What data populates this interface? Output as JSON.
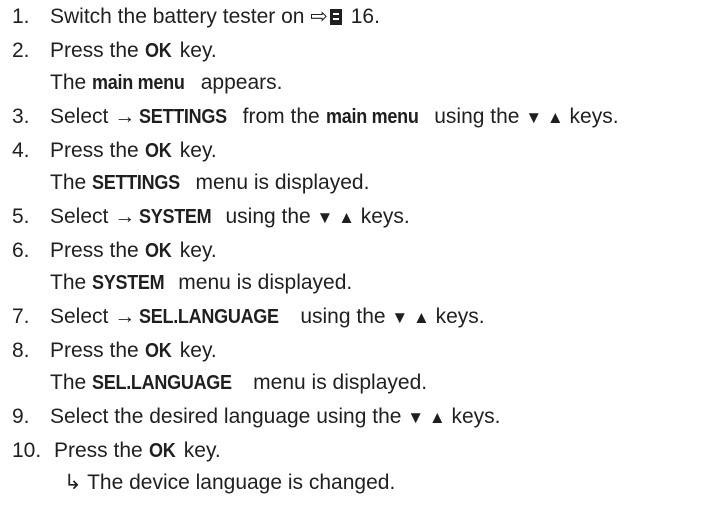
{
  "steps": [
    {
      "num": "1.",
      "a": "Switch the battery tester on ",
      "link_arrow": "⇨",
      "page": " 16."
    },
    {
      "num": "2.",
      "a": "Press the ",
      "b": "OK",
      "c": " key.",
      "result_a": "The ",
      "result_b": "main menu",
      "result_c": " appears."
    },
    {
      "num": "3.",
      "a": "Select ",
      "arrow": "→",
      "b": "SETTINGS",
      "c": " from the ",
      "d": "main menu",
      "e": " using the ",
      "keys": "▼ ▲",
      "f": " keys."
    },
    {
      "num": "4.",
      "a": "Press the ",
      "b": "OK",
      "c": " key.",
      "result_a": "The ",
      "result_b": "SETTINGS",
      "result_c": " menu is displayed."
    },
    {
      "num": "5.",
      "a": "Select ",
      "arrow": "→",
      "b": "SYSTEM",
      "c": " using the ",
      "keys": "▼ ▲",
      "d": " keys."
    },
    {
      "num": "6.",
      "a": "Press the ",
      "b": "OK",
      "c": " key.",
      "result_a": "The ",
      "result_b": "SYSTEM",
      "result_c": " menu is displayed."
    },
    {
      "num": "7.",
      "a": "Select ",
      "arrow": "→",
      "b": "SEL.LANGUAGE",
      "c": " using the ",
      "keys": "▼ ▲",
      "d": " keys."
    },
    {
      "num": "8.",
      "a": "Press the ",
      "b": "OK",
      "c": " key.",
      "result_a": "The ",
      "result_b": "SEL.LANGUAGE",
      "result_c": " menu is displayed."
    },
    {
      "num": "9.",
      "a": "Select the desired language using the ",
      "keys": "▼ ▲",
      "b": " keys."
    },
    {
      "num": "10.",
      "a": "Press the ",
      "b": "OK",
      "c": " key.",
      "result_arrow": "↳",
      "result_text": " The device language is changed."
    }
  ]
}
